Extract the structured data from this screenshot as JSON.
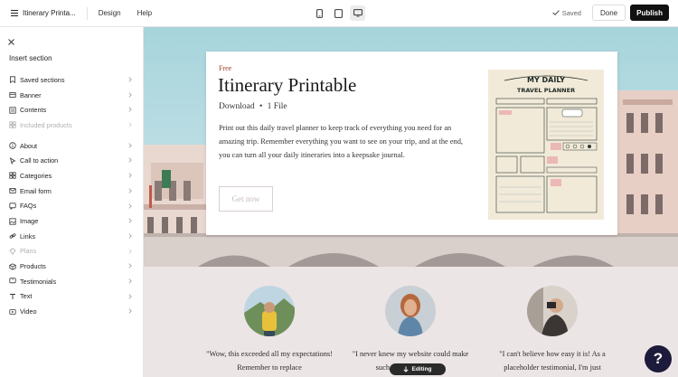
{
  "topbar": {
    "site_title": "Itinerary Printa...",
    "design_label": "Design",
    "help_label": "Help",
    "devices": [
      "mobile-icon",
      "tablet-icon",
      "desktop-icon"
    ],
    "active_device": "desktop",
    "saved_label": "Saved",
    "done_label": "Done",
    "publish_label": "Publish"
  },
  "panel": {
    "title": "Insert section",
    "items": [
      {
        "label": "Saved sections",
        "icon": "bookmark-icon",
        "enabled": true
      },
      {
        "label": "Banner",
        "icon": "banner-icon",
        "enabled": true
      },
      {
        "label": "Contents",
        "icon": "contents-icon",
        "enabled": true
      },
      {
        "label": "Included products",
        "icon": "products-icon",
        "enabled": false
      },
      {
        "label": "About",
        "icon": "info-icon",
        "enabled": true
      },
      {
        "label": "Call to action",
        "icon": "cursor-icon",
        "enabled": true
      },
      {
        "label": "Categories",
        "icon": "categories-icon",
        "enabled": true
      },
      {
        "label": "Email form",
        "icon": "mail-icon",
        "enabled": true
      },
      {
        "label": "FAQs",
        "icon": "faq-icon",
        "enabled": true
      },
      {
        "label": "Image",
        "icon": "image-icon",
        "enabled": true
      },
      {
        "label": "Links",
        "icon": "link-icon",
        "enabled": true
      },
      {
        "label": "Plans",
        "icon": "plans-icon",
        "enabled": false
      },
      {
        "label": "Products",
        "icon": "box-icon",
        "enabled": true
      },
      {
        "label": "Testimonials",
        "icon": "testimonial-icon",
        "enabled": true
      },
      {
        "label": "Text",
        "icon": "text-icon",
        "enabled": true
      },
      {
        "label": "Video",
        "icon": "video-icon",
        "enabled": true
      }
    ]
  },
  "hero": {
    "eyebrow": "Free",
    "title": "Itinerary Printable",
    "meta_download": "Download",
    "meta_bullet": "•",
    "meta_files": "1 File",
    "description": "Print out this daily travel planner to keep track of everything you need for an amazing trip. Remember everything you want to see on your trip, and at the end, you can turn all your daily itineraries into a keepsake journal.",
    "cta_label": "Get now",
    "planner_title_1": "MY DAILY",
    "planner_title_2": "TRAVEL PLANNER"
  },
  "testimonials": [
    {
      "quote": "\"Wow, this exceeded all my expectations! Remember to replace"
    },
    {
      "quote": "\"I never knew my website could make such a difference! This"
    },
    {
      "quote": "\"I can't believe how easy it is! As a placeholder testimonial, I'm just"
    }
  ],
  "editing_label": "Editing",
  "help_button": "?",
  "colors": {
    "accent": "#9a3b2a",
    "publish_bg": "#111111",
    "help_bg": "#1d1b3b",
    "sky": "#9fcfd8"
  }
}
